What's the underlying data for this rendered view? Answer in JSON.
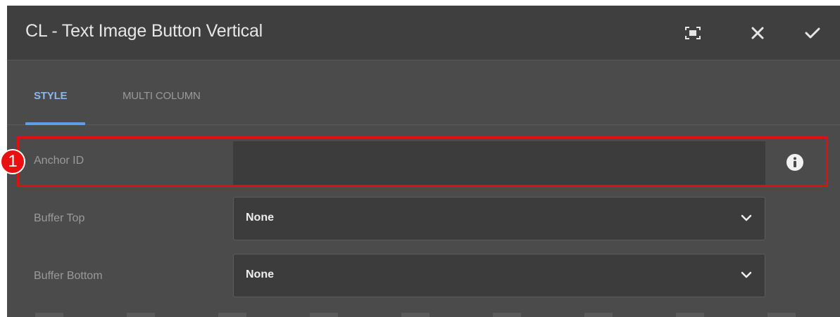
{
  "dialog": {
    "title": "CL - Text Image Button Vertical",
    "toolbar": {
      "fullscreen_icon": "fullscreen-icon",
      "close_icon": "close-icon",
      "confirm_icon": "checkmark-icon"
    },
    "tabs": [
      {
        "label": "STYLE",
        "active": true
      },
      {
        "label": "MULTI COLUMN",
        "active": false
      }
    ]
  },
  "form": {
    "anchor_id": {
      "label": "Anchor ID",
      "value": "",
      "icon": "info-icon"
    },
    "buffer_top": {
      "label": "Buffer Top",
      "value": "None"
    },
    "buffer_bottom": {
      "label": "Buffer Bottom",
      "value": "None"
    }
  },
  "annotation": {
    "badge": "1",
    "color": "#e01010"
  },
  "colors": {
    "accent": "#5f9fe8",
    "panel": "#4b4b4b",
    "titlebar": "#3f3f3f"
  }
}
